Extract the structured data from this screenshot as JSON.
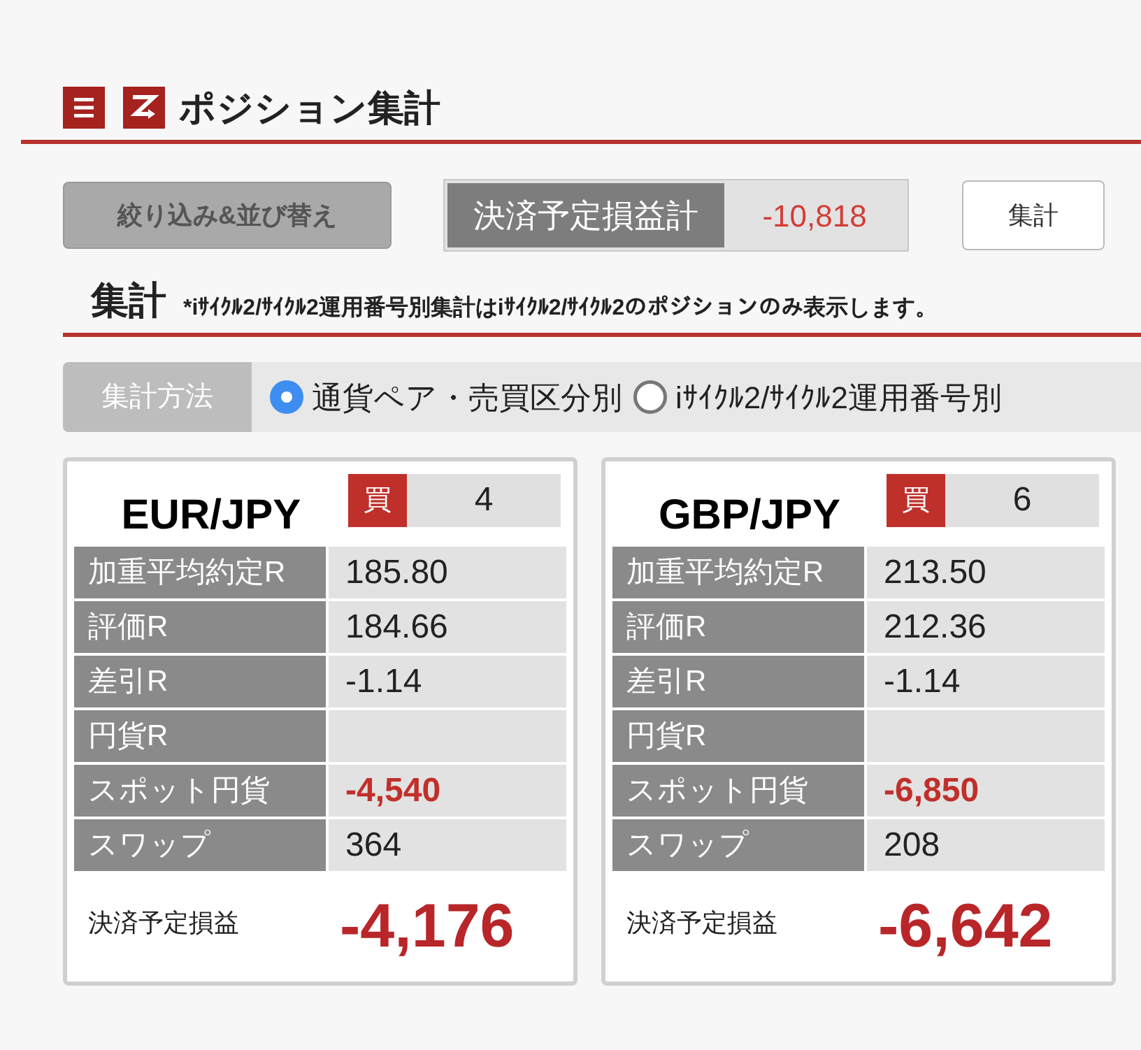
{
  "header": {
    "title": "ポジション集計"
  },
  "toolbar": {
    "filter_button": "絞り込み&並び替え",
    "total": {
      "label": "決済予定損益計",
      "value": "-10,818"
    },
    "aggregate_button": "集計"
  },
  "section": {
    "title": "集計",
    "note": "*iｻｲｸﾙ2/ｻｲｸﾙ2運用番号別集計はiｻｲｸﾙ2/ｻｲｸﾙ2のポジションのみ表示します。"
  },
  "method": {
    "label": "集計方法",
    "options": [
      {
        "label": "通貨ペア・売買区分別",
        "selected": true
      },
      {
        "label": "iｻｲｸﾙ2/ｻｲｸﾙ2運用番号別",
        "selected": false
      }
    ]
  },
  "positions": [
    {
      "pair": "EUR/JPY",
      "side": {
        "label": "買",
        "kind": "buy"
      },
      "count": "4",
      "rows": [
        {
          "label": "加重平均約定R",
          "value": "185.80",
          "kind": "normal"
        },
        {
          "label": "評価R",
          "value": "184.66",
          "kind": "normal"
        },
        {
          "label": "差引R",
          "value": "-1.14",
          "kind": "normal"
        },
        {
          "label": "円貨R",
          "kind": "normal"
        },
        {
          "label": "スポット円貨",
          "value": "-4,540",
          "kind": "emphasis"
        },
        {
          "label": "スワップ",
          "value": "364",
          "kind": "normal"
        }
      ],
      "total": {
        "label": "決済予定損益",
        "value": "-4,176"
      }
    },
    {
      "pair": "GBP/JPY",
      "side": {
        "label": "買",
        "kind": "buy"
      },
      "count": "6",
      "rows": [
        {
          "label": "加重平均約定R",
          "value": "213.50",
          "kind": "normal"
        },
        {
          "label": "評価R",
          "value": "212.36",
          "kind": "normal"
        },
        {
          "label": "差引R",
          "value": "-1.14",
          "kind": "normal"
        },
        {
          "label": "円貨R",
          "kind": "normal"
        },
        {
          "label": "スポット円貨",
          "value": "-6,850",
          "kind": "emphasis"
        },
        {
          "label": "スワップ",
          "value": "208",
          "kind": "normal"
        }
      ],
      "total": {
        "label": "決済予定損益",
        "value": "-6,642"
      }
    }
  ]
}
